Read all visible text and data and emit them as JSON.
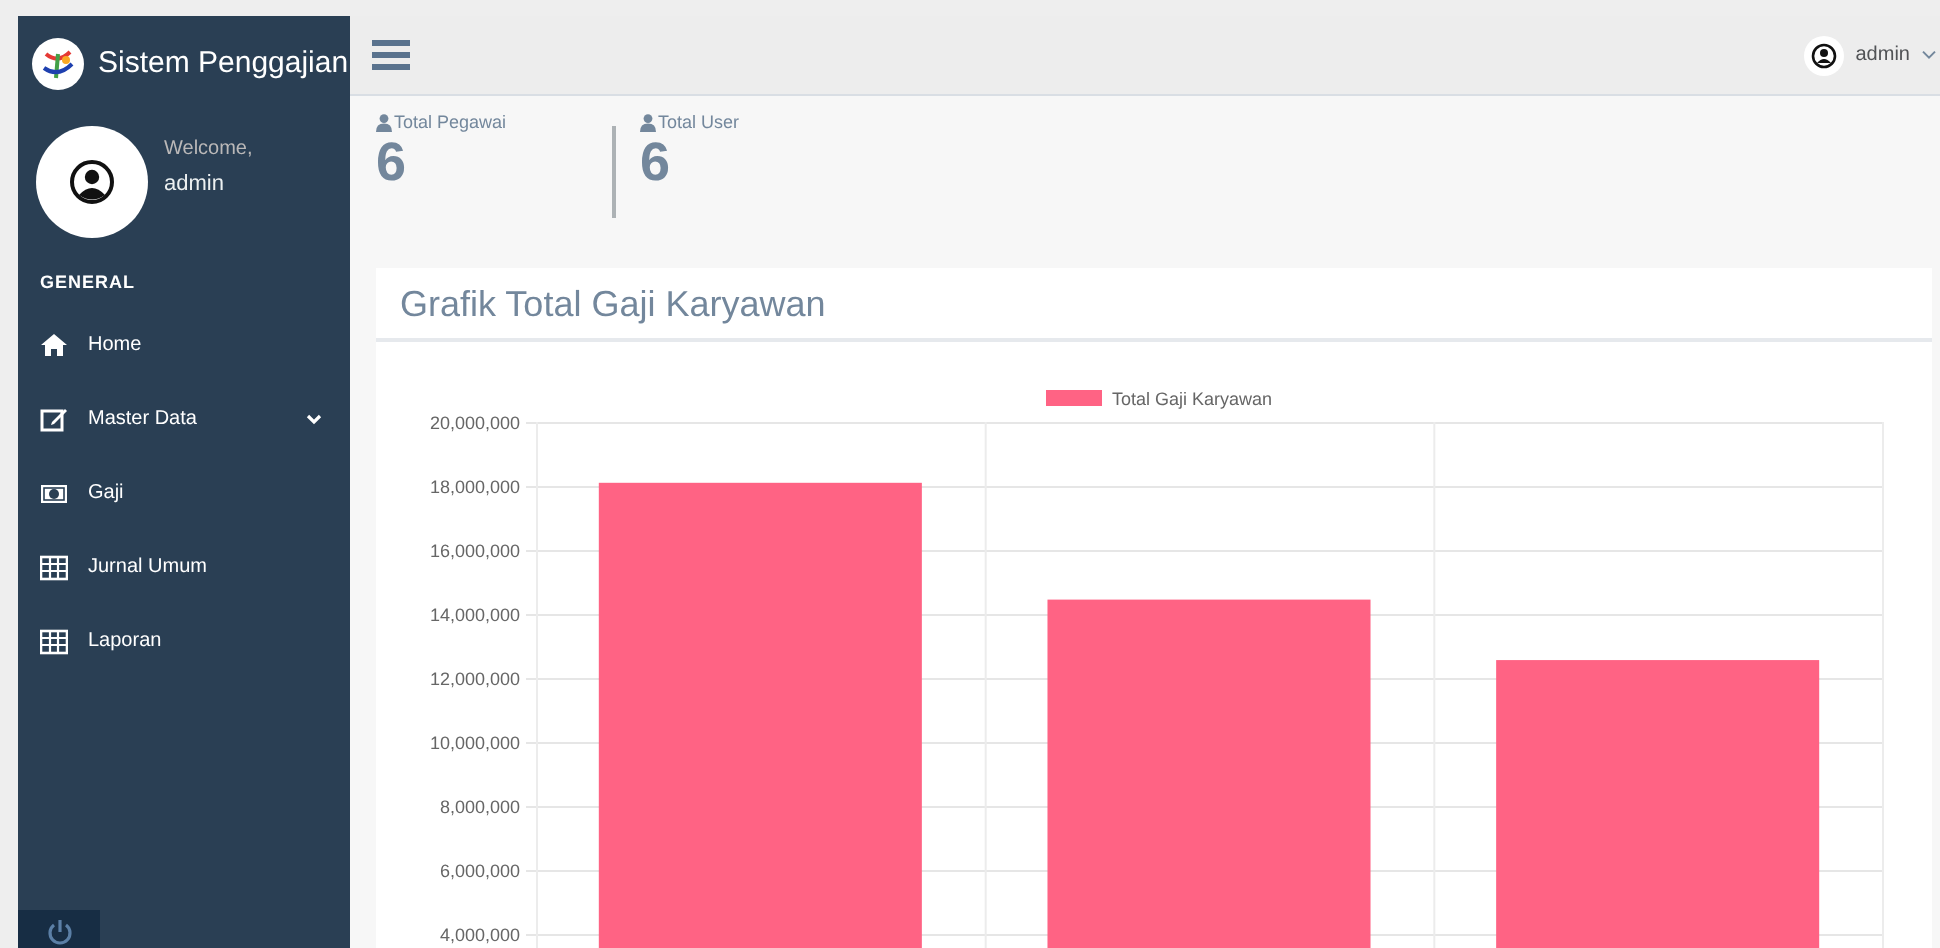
{
  "sidebar": {
    "title": "Sistem Penggajian",
    "welcome": "Welcome,",
    "user": "admin",
    "section": "GENERAL",
    "items": [
      {
        "label": "Home",
        "kind": "home",
        "has_children": false
      },
      {
        "label": "Master Data",
        "kind": "edit",
        "has_children": true
      },
      {
        "label": "Gaji",
        "kind": "money",
        "has_children": false
      },
      {
        "label": "Jurnal Umum",
        "kind": "table",
        "has_children": false
      },
      {
        "label": "Laporan",
        "kind": "table",
        "has_children": false
      }
    ]
  },
  "topbar": {
    "user": "admin"
  },
  "stats": [
    {
      "label": "Total Pegawai",
      "value": "6"
    },
    {
      "label": "Total User",
      "value": "6"
    }
  ],
  "panel": {
    "title": "Grafik Total Gaji Karyawan",
    "chart_data": {
      "type": "bar",
      "grid": true,
      "ylim": [
        0,
        20000000
      ],
      "yticks": [
        {
          "value": 4000000,
          "label": "4,000,000"
        },
        {
          "value": 6000000,
          "label": "6,000,000"
        },
        {
          "value": 8000000,
          "label": "8,000,000"
        },
        {
          "value": 10000000,
          "label": "10,000,000"
        },
        {
          "value": 12000000,
          "label": "12,000,000"
        },
        {
          "value": 14000000,
          "label": "14,000,000"
        },
        {
          "value": 16000000,
          "label": "16,000,000"
        },
        {
          "value": 18000000,
          "label": "18,000,000"
        },
        {
          "value": 20000000,
          "label": "20,000,000"
        }
      ],
      "series": [
        {
          "name": "Total Gaji Karyawan",
          "color": "#ff6384",
          "values": [
            18100000,
            14450000,
            12560000
          ]
        }
      ]
    }
  }
}
